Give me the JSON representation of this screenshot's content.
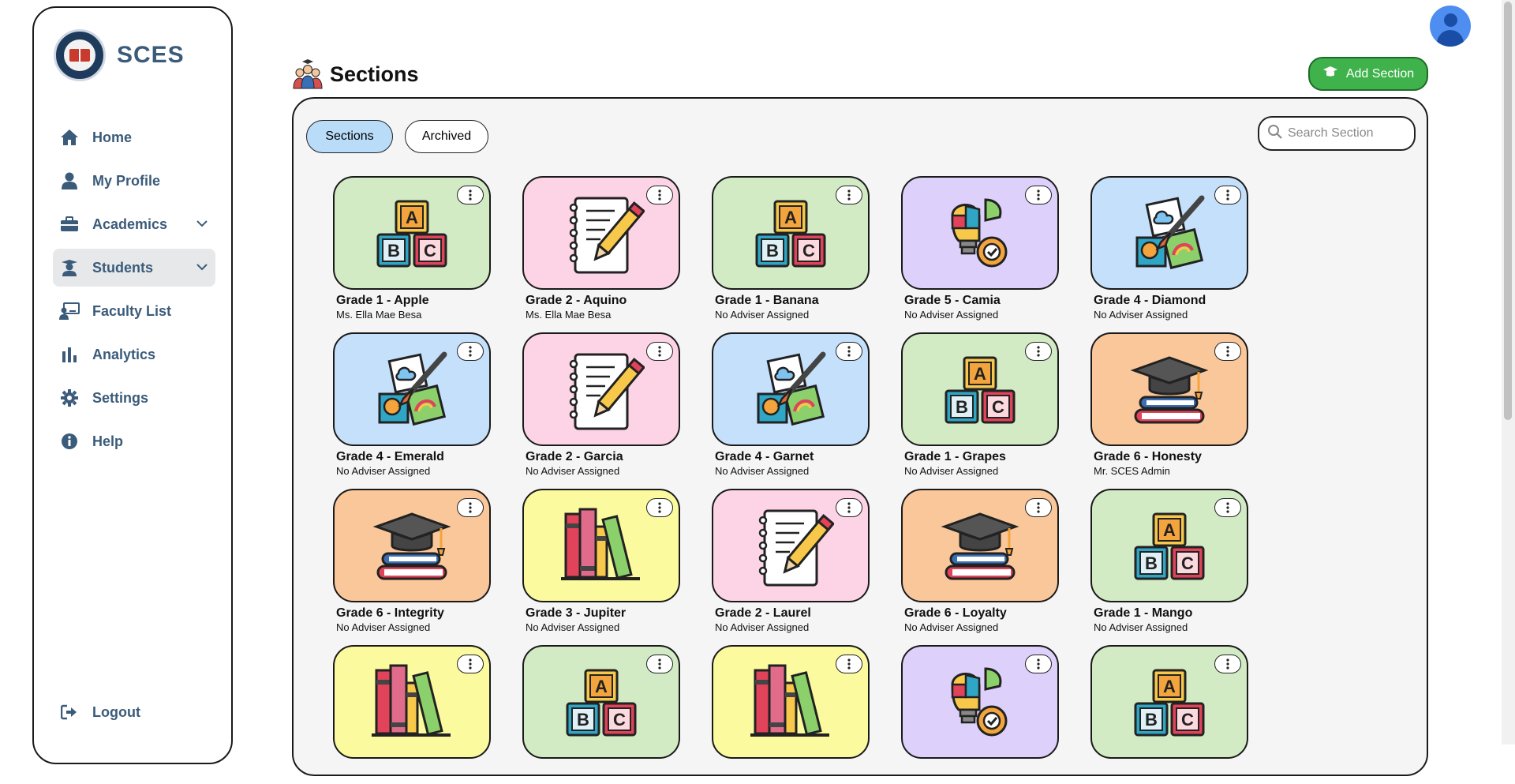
{
  "sidebar": {
    "brand": "SCES",
    "items": [
      {
        "label": "Home",
        "icon": "home-icon"
      },
      {
        "label": "My Profile",
        "icon": "user-icon"
      },
      {
        "label": "Academics",
        "icon": "briefcase-icon",
        "expandable": true
      },
      {
        "label": "Students",
        "icon": "student-icon",
        "expandable": true,
        "active": true
      },
      {
        "label": "Faculty List",
        "icon": "teacher-board-icon"
      },
      {
        "label": "Analytics",
        "icon": "bar-chart-icon"
      },
      {
        "label": "Settings",
        "icon": "gear-icon"
      },
      {
        "label": "Help",
        "icon": "info-icon"
      }
    ],
    "logout": "Logout"
  },
  "header": {
    "title": "Sections",
    "add_button": "Add Section"
  },
  "tabs": {
    "sections": "Sections",
    "archived": "Archived",
    "active": "sections"
  },
  "search": {
    "placeholder": "Search Section"
  },
  "colors": {
    "green": "#d2ebc4",
    "pink": "#fdd4e6",
    "purple": "#ddd1fb",
    "blue": "#c5e0fb",
    "orange": "#fac79a",
    "yellow": "#fbfa9e",
    "accent_button": "#3fb24c",
    "nav_text": "#3b5b7a"
  },
  "sections": [
    {
      "name": "Grade 1 - Apple",
      "adviser": "Ms. Ella Mae Besa",
      "bg": "green",
      "art": "abc-blocks"
    },
    {
      "name": "Grade 2 - Aquino",
      "adviser": "Ms. Ella Mae Besa",
      "bg": "pink",
      "art": "notebook-pencil"
    },
    {
      "name": "Grade 1 - Banana",
      "adviser": "No Adviser Assigned",
      "bg": "green",
      "art": "abc-blocks"
    },
    {
      "name": "Grade 5 - Camia",
      "adviser": "No Adviser Assigned",
      "bg": "purple",
      "art": "puzzle-bulb"
    },
    {
      "name": "Grade 4 - Diamond",
      "adviser": "No Adviser Assigned",
      "bg": "blue",
      "art": "art-brush"
    },
    {
      "name": "Grade 4 - Emerald",
      "adviser": "No Adviser Assigned",
      "bg": "blue",
      "art": "art-brush"
    },
    {
      "name": "Grade 2 - Garcia",
      "adviser": "No Adviser Assigned",
      "bg": "pink",
      "art": "notebook-pencil"
    },
    {
      "name": "Grade 4 - Garnet",
      "adviser": "No Adviser Assigned",
      "bg": "blue",
      "art": "art-brush"
    },
    {
      "name": "Grade 1 - Grapes",
      "adviser": "No Adviser Assigned",
      "bg": "green",
      "art": "abc-blocks"
    },
    {
      "name": "Grade 6 - Honesty",
      "adviser": "Mr. SCES Admin",
      "bg": "orange",
      "art": "grad-cap-books"
    },
    {
      "name": "Grade 6 - Integrity",
      "adviser": "No Adviser Assigned",
      "bg": "orange",
      "art": "grad-cap-books"
    },
    {
      "name": "Grade 3 - Jupiter",
      "adviser": "No Adviser Assigned",
      "bg": "yellow",
      "art": "bookshelf"
    },
    {
      "name": "Grade 2 - Laurel",
      "adviser": "No Adviser Assigned",
      "bg": "pink",
      "art": "notebook-pencil"
    },
    {
      "name": "Grade 6 - Loyalty",
      "adviser": "No Adviser Assigned",
      "bg": "orange",
      "art": "grad-cap-books"
    },
    {
      "name": "Grade 1 - Mango",
      "adviser": "No Adviser Assigned",
      "bg": "green",
      "art": "abc-blocks"
    },
    {
      "name": "",
      "adviser": "",
      "bg": "yellow",
      "art": "bookshelf"
    },
    {
      "name": "",
      "adviser": "",
      "bg": "green",
      "art": "abc-blocks"
    },
    {
      "name": "",
      "adviser": "",
      "bg": "yellow",
      "art": "bookshelf"
    },
    {
      "name": "",
      "adviser": "",
      "bg": "purple",
      "art": "puzzle-bulb"
    },
    {
      "name": "",
      "adviser": "",
      "bg": "green",
      "art": "abc-blocks"
    }
  ]
}
